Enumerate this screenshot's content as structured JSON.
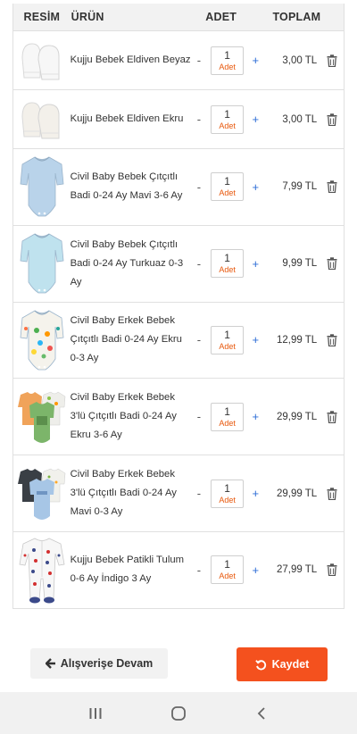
{
  "table": {
    "headers": {
      "image": "RESİM",
      "product": "ÜRÜN",
      "quantity": "ADET",
      "total": "TOPLAM"
    },
    "qty_unit": "Adet",
    "items": [
      {
        "name": "Kujju Bebek Eldiven Beyaz",
        "qty": "1",
        "total": "3,00 TL",
        "image": "white-mittens"
      },
      {
        "name": "Kujju Bebek Eldiven Ekru",
        "qty": "1",
        "total": "3,00 TL",
        "image": "ecru-mittens"
      },
      {
        "name": "Civil Baby Bebek Çıtçıtlı Badi 0-24 Ay Mavi 3-6 Ay",
        "qty": "1",
        "total": "7,99 TL",
        "image": "blue-bodysuit"
      },
      {
        "name": "Civil Baby Bebek Çıtçıtlı Badi 0-24 Ay Turkuaz 0-3 Ay",
        "qty": "1",
        "total": "9,99 TL",
        "image": "turquoise-bodysuit"
      },
      {
        "name": "Civil Baby Erkek Bebek Çıtçıtlı Badi 0-24 Ay Ekru 0-3 Ay",
        "qty": "1",
        "total": "12,99 TL",
        "image": "printed-bodysuit"
      },
      {
        "name": "Civil Baby Erkek Bebek 3'lü Çıtçıtlı Badi 0-24 Ay Ekru 3-6 Ay",
        "qty": "1",
        "total": "29,99 TL",
        "image": "bodysuit-set-ecru"
      },
      {
        "name": "Civil Baby Erkek Bebek 3'lü Çıtçıtlı Badi 0-24 Ay Mavi 0-3 Ay",
        "qty": "1",
        "total": "29,99 TL",
        "image": "bodysuit-set-blue"
      },
      {
        "name": "Kujju Bebek Patikli Tulum 0-6 Ay İndigo 3 Ay",
        "qty": "1",
        "total": "27,99 TL",
        "image": "footed-romper"
      }
    ],
    "minus_label": "-",
    "plus_label": "+"
  },
  "actions": {
    "continue_label": "Alışverişe Devam",
    "save_label": "Kaydet"
  },
  "colors": {
    "accent": "#f4511e",
    "plus": "#2c6cd6",
    "unit": "#e8580c"
  }
}
